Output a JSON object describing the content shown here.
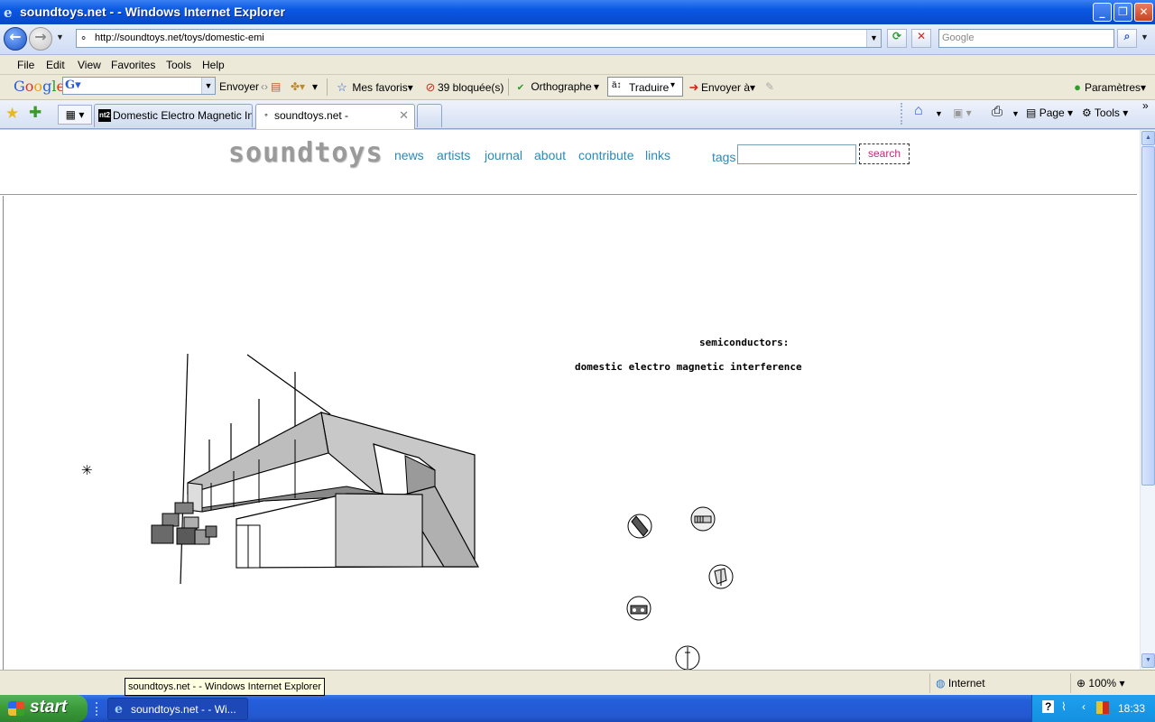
{
  "window": {
    "title": "soundtoys.net - - Windows Internet Explorer",
    "min_label": "_",
    "max_label": "❐",
    "close_label": "✕"
  },
  "address": {
    "url": "http://soundtoys.net/toys/domestic-emi",
    "search_placeholder": "Google"
  },
  "menu": [
    "File",
    "Edit",
    "View",
    "Favorites",
    "Tools",
    "Help"
  ],
  "google_toolbar": {
    "logo": "Google",
    "send": "Envoyer",
    "favorites": "Mes favoris",
    "blocked": "39 bloquée(s)",
    "spelling": "Orthographe",
    "translate": "Traduire",
    "send_to": "Envoyer à",
    "settings": "Paramètres"
  },
  "tabs": [
    {
      "title": "Domestic Electro Magnetic In...",
      "icon": "nt2"
    },
    {
      "title": "soundtoys.net -"
    }
  ],
  "tab_tools": {
    "page": "Page",
    "tools": "Tools"
  },
  "site": {
    "logo": "soundtoys",
    "nav": [
      "news",
      "artists",
      "journal",
      "about",
      "contribute",
      "links"
    ],
    "tags_label": "tags",
    "tags_value": "",
    "search_button": "search"
  },
  "flash": {
    "heading": "semiconductors:",
    "subtitle": "domestic electro magnetic interference"
  },
  "status": {
    "tooltip": "soundtoys.net - - Windows Internet Explorer",
    "zone": "Internet",
    "zoom": "100%"
  },
  "taskbar": {
    "start": "start",
    "item": "soundtoys.net - - Wi...",
    "clock": "18:33"
  },
  "icons": {
    "back": "←",
    "forward": "→",
    "refresh": "⟳",
    "stop": "✕",
    "search": "⌕",
    "star": "★",
    "add_fav": "✚",
    "home": "⌂",
    "print": "⎙",
    "gear": "⚙",
    "chevrons": "»",
    "asterisk": "✳"
  }
}
